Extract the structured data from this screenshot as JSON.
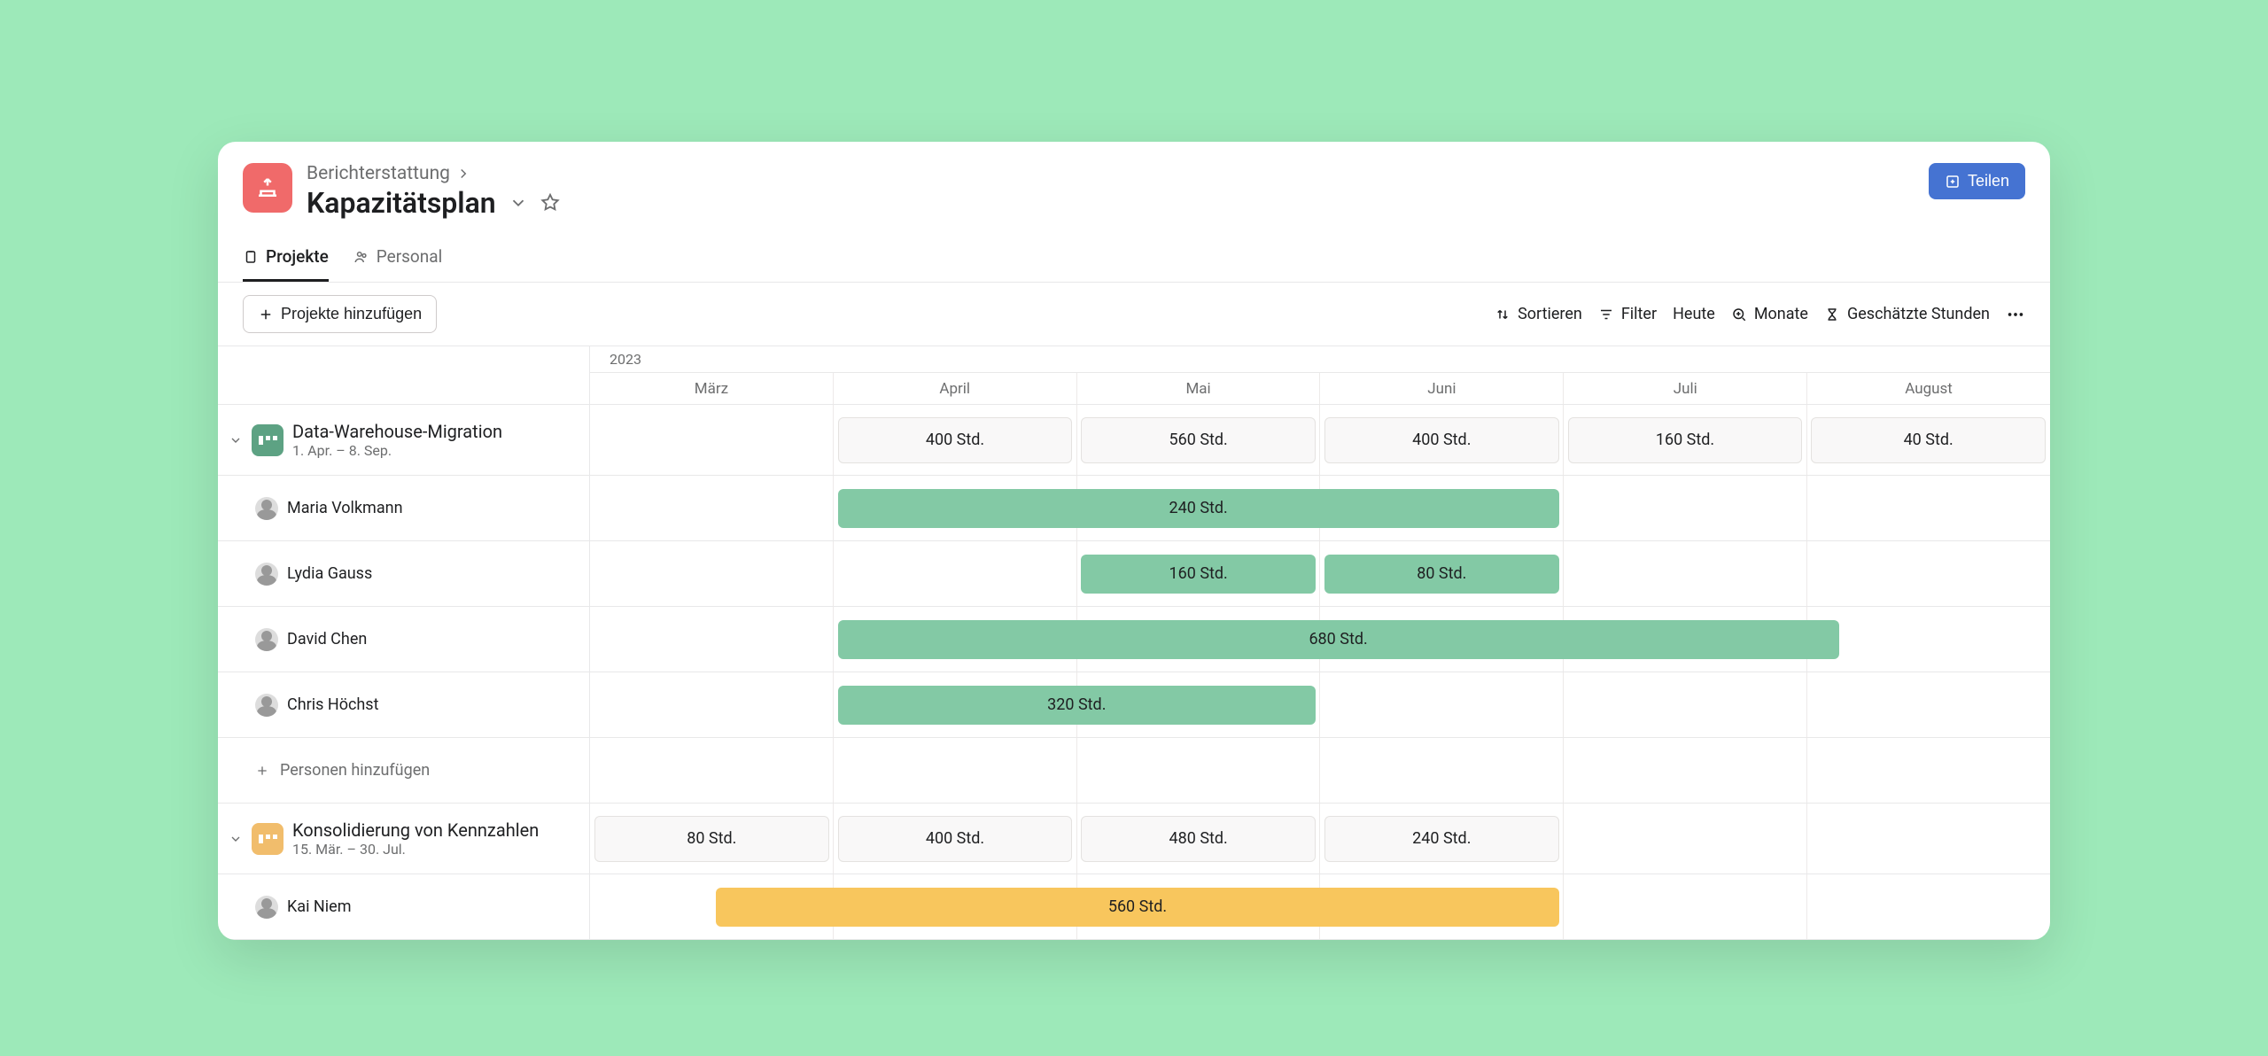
{
  "breadcrumb": "Berichterstattung",
  "title": "Kapazitätsplan",
  "share_label": "Teilen",
  "tabs": {
    "projects": "Projekte",
    "personnel": "Personal"
  },
  "toolbar": {
    "add_projects": "Projekte hinzufügen",
    "sort": "Sortieren",
    "filter": "Filter",
    "today": "Heute",
    "months": "Monate",
    "estimated": "Geschätzte Stunden"
  },
  "year": "2023",
  "months": [
    "März",
    "April",
    "Mai",
    "Juni",
    "Juli",
    "August"
  ],
  "projects": [
    {
      "title": "Data-Warehouse-Migration",
      "dates": "1. Apr. – 8. Sep.",
      "color": "green",
      "summary": [
        {
          "month": "April",
          "label": "400 Std."
        },
        {
          "month": "Mai",
          "label": "560 Std."
        },
        {
          "month": "Juni",
          "label": "400 Std."
        },
        {
          "month": "Juli",
          "label": "160 Std."
        },
        {
          "month": "August",
          "label": "40 Std."
        }
      ],
      "people": [
        {
          "name": "Maria Volkmann",
          "bar": {
            "start": 1,
            "span": 3,
            "label": "240 Std."
          }
        },
        {
          "name": "Lydia Gauss",
          "bar": {
            "start": 2,
            "span": 1,
            "label": "160 Std."
          },
          "bar2": {
            "start": 3,
            "span": 1,
            "label": "80 Std."
          }
        },
        {
          "name": "David Chen",
          "bar": {
            "start": 1,
            "span": 4.15,
            "label": "680 Std."
          }
        },
        {
          "name": "Chris Höchst",
          "bar": {
            "start": 1,
            "span": 2,
            "label": "320 Std."
          }
        }
      ],
      "add_people": "Personen hinzufügen"
    },
    {
      "title": "Konsolidierung von Kennzahlen",
      "dates": "15. Mär. – 30. Jul.",
      "color": "yellow",
      "summary": [
        {
          "month": "März",
          "label": "80 Std."
        },
        {
          "month": "April",
          "label": "400 Std."
        },
        {
          "month": "Mai",
          "label": "480 Std."
        },
        {
          "month": "Juni",
          "label": "240 Std."
        }
      ],
      "people": [
        {
          "name": "Kai Niem",
          "bar": {
            "start": 0.5,
            "span": 3.5,
            "label": "560 Std."
          }
        }
      ]
    }
  ]
}
